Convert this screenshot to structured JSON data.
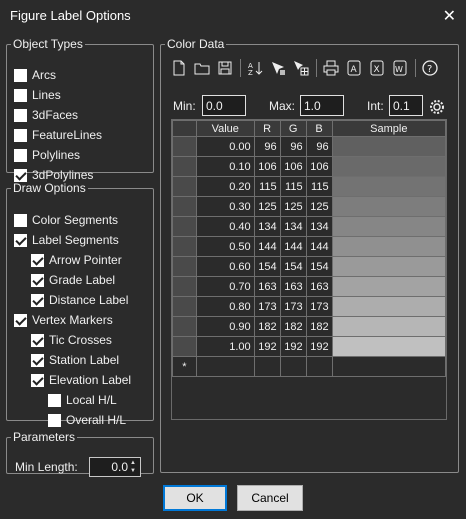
{
  "window": {
    "title": "Figure Label Options"
  },
  "object_types": {
    "legend": "Object Types",
    "items": [
      {
        "label": "Arcs",
        "checked": false
      },
      {
        "label": "Lines",
        "checked": false
      },
      {
        "label": "3dFaces",
        "checked": false
      },
      {
        "label": "FeatureLines",
        "checked": false
      },
      {
        "label": "Polylines",
        "checked": false
      },
      {
        "label": "3dPolylines",
        "checked": true
      }
    ]
  },
  "draw_options": {
    "legend": "Draw Options",
    "items": [
      {
        "label": "Color Segments",
        "checked": false,
        "level": 0
      },
      {
        "label": "Label Segments",
        "checked": true,
        "level": 0
      },
      {
        "label": "Arrow Pointer",
        "checked": true,
        "level": 1
      },
      {
        "label": "Grade Label",
        "checked": true,
        "level": 1
      },
      {
        "label": "Distance Label",
        "checked": true,
        "level": 1
      },
      {
        "label": "Vertex Markers",
        "checked": true,
        "level": 0
      },
      {
        "label": "Tic Crosses",
        "checked": true,
        "level": 1
      },
      {
        "label": "Station Label",
        "checked": true,
        "level": 1
      },
      {
        "label": "Elevation Label",
        "checked": true,
        "level": 1
      },
      {
        "label": "Local H/L",
        "checked": false,
        "level": 2
      },
      {
        "label": "Overall H/L",
        "checked": false,
        "level": 2
      }
    ]
  },
  "parameters": {
    "legend": "Parameters",
    "min_length_label": "Min Length:",
    "min_length_value": "0.0"
  },
  "color_data": {
    "legend": "Color Data",
    "toolbar_icons": [
      "new-file-icon",
      "open-folder-icon",
      "save-icon",
      "sort-icon",
      "select-icon",
      "grid-select-icon",
      "print-icon",
      "export-a-icon",
      "export-x-icon",
      "export-w-icon",
      "help-icon"
    ],
    "min_label": "Min:",
    "min_value": "0.0",
    "max_label": "Max:",
    "max_value": "1.0",
    "int_label": "Int:",
    "int_value": "0.1",
    "columns": [
      "Value",
      "R",
      "G",
      "B",
      "Sample"
    ],
    "rows": [
      {
        "value": "0.00",
        "r": "96",
        "g": "96",
        "b": "96",
        "color": "#606060"
      },
      {
        "value": "0.10",
        "r": "106",
        "g": "106",
        "b": "106",
        "color": "#6a6a6a"
      },
      {
        "value": "0.20",
        "r": "115",
        "g": "115",
        "b": "115",
        "color": "#737373"
      },
      {
        "value": "0.30",
        "r": "125",
        "g": "125",
        "b": "125",
        "color": "#7d7d7d"
      },
      {
        "value": "0.40",
        "r": "134",
        "g": "134",
        "b": "134",
        "color": "#868686"
      },
      {
        "value": "0.50",
        "r": "144",
        "g": "144",
        "b": "144",
        "color": "#909090"
      },
      {
        "value": "0.60",
        "r": "154",
        "g": "154",
        "b": "154",
        "color": "#9a9a9a"
      },
      {
        "value": "0.70",
        "r": "163",
        "g": "163",
        "b": "163",
        "color": "#a3a3a3"
      },
      {
        "value": "0.80",
        "r": "173",
        "g": "173",
        "b": "173",
        "color": "#adadad"
      },
      {
        "value": "0.90",
        "r": "182",
        "g": "182",
        "b": "182",
        "color": "#b6b6b6"
      },
      {
        "value": "1.00",
        "r": "192",
        "g": "192",
        "b": "192",
        "color": "#c0c0c0"
      }
    ],
    "new_row_marker": "*"
  },
  "buttons": {
    "ok": "OK",
    "cancel": "Cancel"
  },
  "colors": {
    "background": "#2b2b2b",
    "text": "#f0f0f0",
    "accent": "#0078d7"
  }
}
